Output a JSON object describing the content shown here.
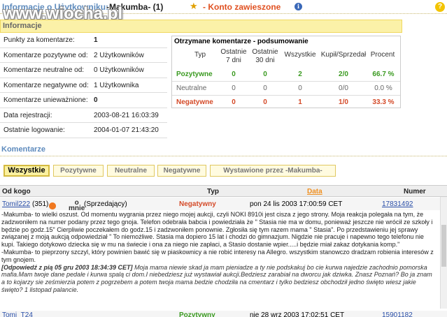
{
  "title": {
    "prefix": "Informacje o Użytkowniku:",
    "user": "-Makumba- (1)",
    "status": "- Konto zawieszone",
    "info_icon": "i",
    "help_icon": "?"
  },
  "watermark": "www.wiocha.pl",
  "info_header": "Informacje",
  "left_rows": [
    {
      "label": "Punkty za komentarze:",
      "value": "1"
    },
    {
      "label": "Komentarze pozytywne od:",
      "value": "2 Użytkowników"
    },
    {
      "label": "Komentarze neutralne od:",
      "value": "0 Użytkowników"
    },
    {
      "label": "Komentarze negatywne od:",
      "value": "1 Użytkownika"
    },
    {
      "label": "Komentarze unieważnione:",
      "value": "0"
    },
    {
      "label": "Data rejestracji:",
      "value": "2003-08-21 16:03:39"
    },
    {
      "label": "Ostatnie logowanie:",
      "value": "2004-01-07 21:43:20"
    }
  ],
  "summary": {
    "title": "Otrzymane komentarze - podsumowanie",
    "headers": [
      "Typ",
      "Ostatnie\n7 dni",
      "Ostatnie\n30 dni",
      "Wszystkie",
      "Kupił/Sprzedał",
      "Procent"
    ],
    "rows": [
      {
        "type": "Pozytywne",
        "d7": "0",
        "d30": "0",
        "all": "2",
        "ks": "2/0",
        "pct": "66.7 %"
      },
      {
        "type": "Neutralne",
        "d7": "0",
        "d30": "0",
        "all": "0",
        "ks": "0/0",
        "pct": "0.0 %"
      },
      {
        "type": "Negatywne",
        "d7": "0",
        "d30": "0",
        "all": "1",
        "ks": "1/0",
        "pct": "33.3 %"
      }
    ]
  },
  "comments_title": "Komentarze",
  "tabs": [
    "Wszystkie",
    "Pozytywne",
    "Neutralne",
    "Negatywne",
    "Wystawione przez -Makumba-"
  ],
  "table": {
    "headers": {
      "from": "Od kogo",
      "type": "Typ",
      "date": "Data",
      "number": "Numer"
    },
    "row1": {
      "user": "Tomil222",
      "score": "(351)",
      "about": "o\nmnie",
      "role": "(Sprzedający)",
      "type": "Negatywny",
      "date": "pon 24 lis 2003 17:00:59 CET",
      "number": "17831492"
    },
    "comment_p1": "-Makumba- to wielki oszust. Od momentu wygrania przez niego mojej aukcji, czyli NOKI 8910i jest cisza z jego strony. Moja reakcja polegała na tym, że zadzwoniłem na numer podany przez tego gnoja. Telefon odebrała babcia i powiedziała że \" Stasia nie ma w domu, ponieważ jeszcze nie wrócił ze szkoły i będzie po godz.15\" Cierpliwie poczekałem do godz.15 i zadzwoniłem ponownie. Zgłosiła się tym razem mama \" Stasia\". Po przedstawieniu jej sprawy związanej z moją aukcją odpowiedział \" To niemożliwe. Stasia ma dopiero 15 lat i chodzi do gimnazjum. Nigdzie nie pracuje i napewno tego telefonu nie kupi. Takiego dotykowo dziecka się w mu na świecie i ona za niego nie zapłaci, a Stasio dostanie wpier.....i będzie miał zakaz dotykania komp.\"",
    "comment_p2": "-Makumba- to pieprzony szczyl, który powinien bawić się w piaskownicy a nie robić interesy na Allegro. wszystkim stanowczo dradzam robienia interesów z tym gnojem.",
    "answer_label": "[Odpowiedź z pią 05 gru 2003 18:34:39 CET]",
    "answer_text": " Moja mama niewie skad ja mam pieniadze a ty nie podskakuj bo cie kurwa najedzie zachodnio pomorska mafia.Mam twoje dane pedale i kurwa spalą ci dom.I niebedziesz już wystawiał aukcji.Bedziesz zarabiał na dworcu jak dziwka. Znasz Poznań? Bo ja znam a to kojarzy sie ześmierzia potem z pogrzebem a potem twoja mama bedzie chodziła na cmentarz i tylko bedziesz obchodził jedno święto wiesz jakie święto? 1 listopad palancie.",
    "row2": {
      "user": "Tomi_T24",
      "type": "Pozytywny",
      "date": "nie 28 wrz 2003 17:02:51 CET",
      "number": "15901182"
    }
  }
}
